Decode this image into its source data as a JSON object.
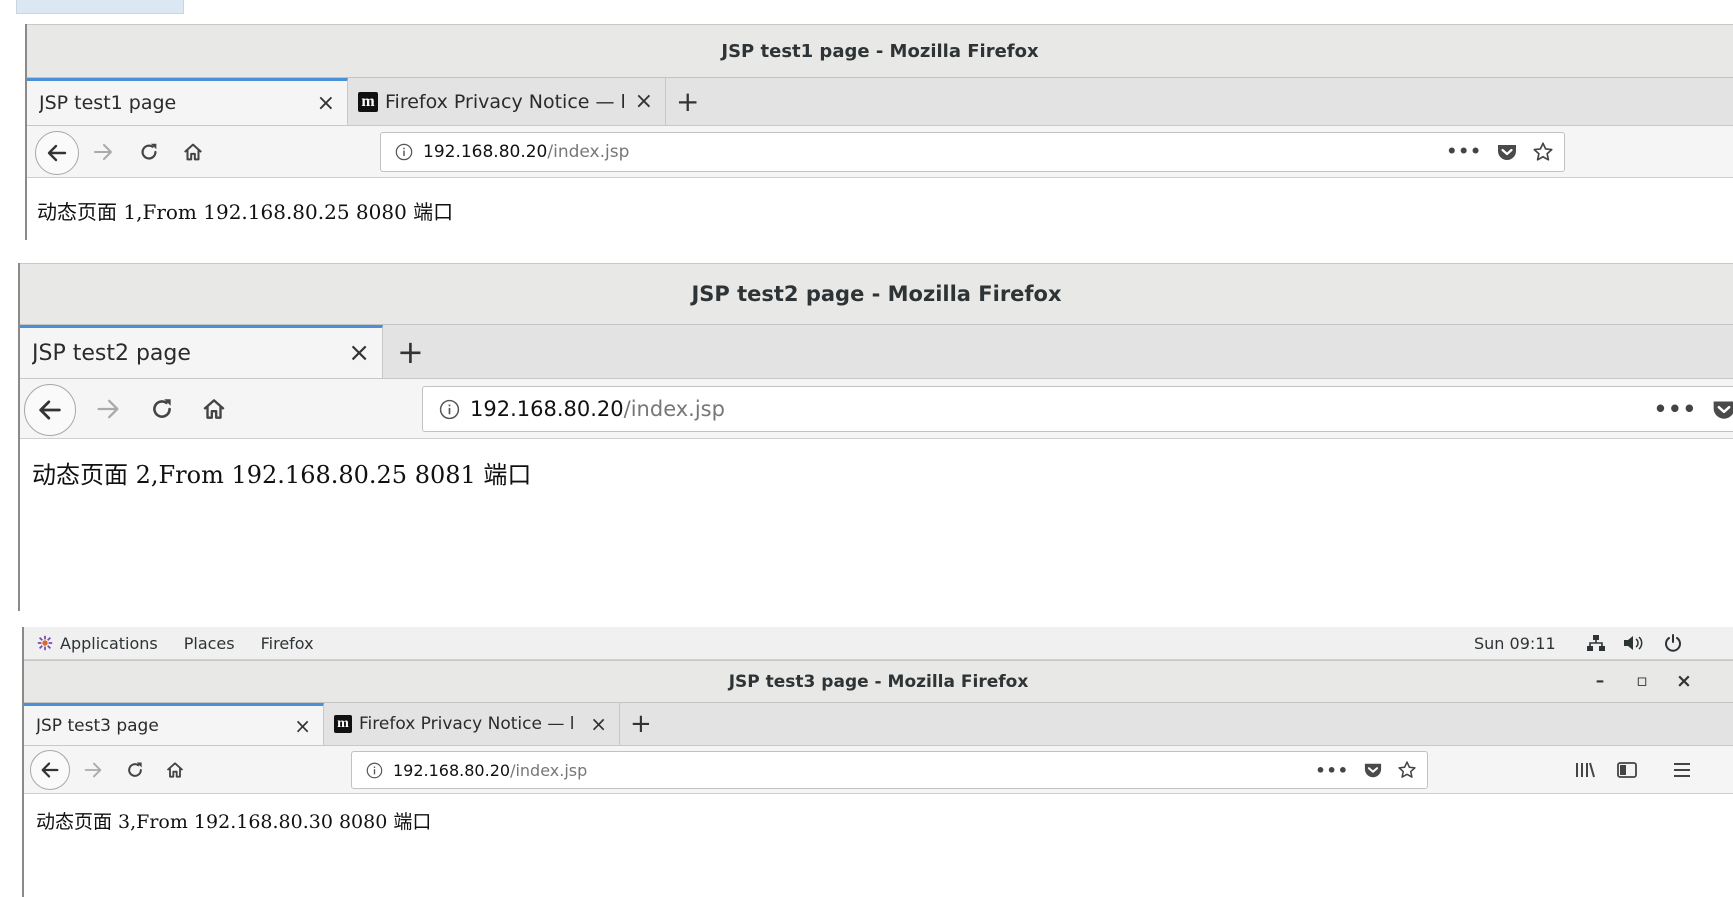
{
  "windows": [
    {
      "window_title": "JSP test1 page - Mozilla Firefox",
      "tabs": [
        {
          "label": "JSP test1 page",
          "active": true
        },
        {
          "label": "Firefox Privacy Notice — l",
          "favicon": "m",
          "active": false
        }
      ],
      "url_host": "192.168.80.20",
      "url_path": "/index.jsp",
      "page_text": "动态页面 1,From 192.168.80.25 8080 端口"
    },
    {
      "window_title": "JSP test2 page - Mozilla Firefox",
      "tabs": [
        {
          "label": "JSP test2 page",
          "active": true
        }
      ],
      "url_host": "192.168.80.20",
      "url_path": "/index.jsp",
      "page_text": "动态页面 2,From 192.168.80.25 8081 端口"
    },
    {
      "top_panel": {
        "applications": "Applications",
        "places": "Places",
        "firefox": "Firefox",
        "clock": "Sun 09:11"
      },
      "window_title": "JSP test3 page - Mozilla Firefox",
      "tabs": [
        {
          "label": "JSP test3 page",
          "active": true
        },
        {
          "label": "Firefox Privacy Notice — l",
          "favicon": "m",
          "active": false
        }
      ],
      "url_host": "192.168.80.20",
      "url_path": "/index.jsp",
      "page_text": "动态页面 3,From 192.168.80.30 8080 端口"
    }
  ],
  "icons": {
    "close_tab": "×",
    "new_tab": "+",
    "back": "back-arrow-icon",
    "forward": "forward-arrow-icon",
    "reload": "reload-icon",
    "home": "home-icon",
    "info": "info-icon",
    "page_actions": "•••",
    "pocket": "pocket-icon",
    "bookmark": "star-icon",
    "minimize": "–",
    "maximize": "▫",
    "close_window": "×"
  },
  "colors": {
    "tab_accent": "#4a90d9",
    "titlebar_bg": "#e8e8e7",
    "navbar_bg": "#f5f5f5"
  }
}
